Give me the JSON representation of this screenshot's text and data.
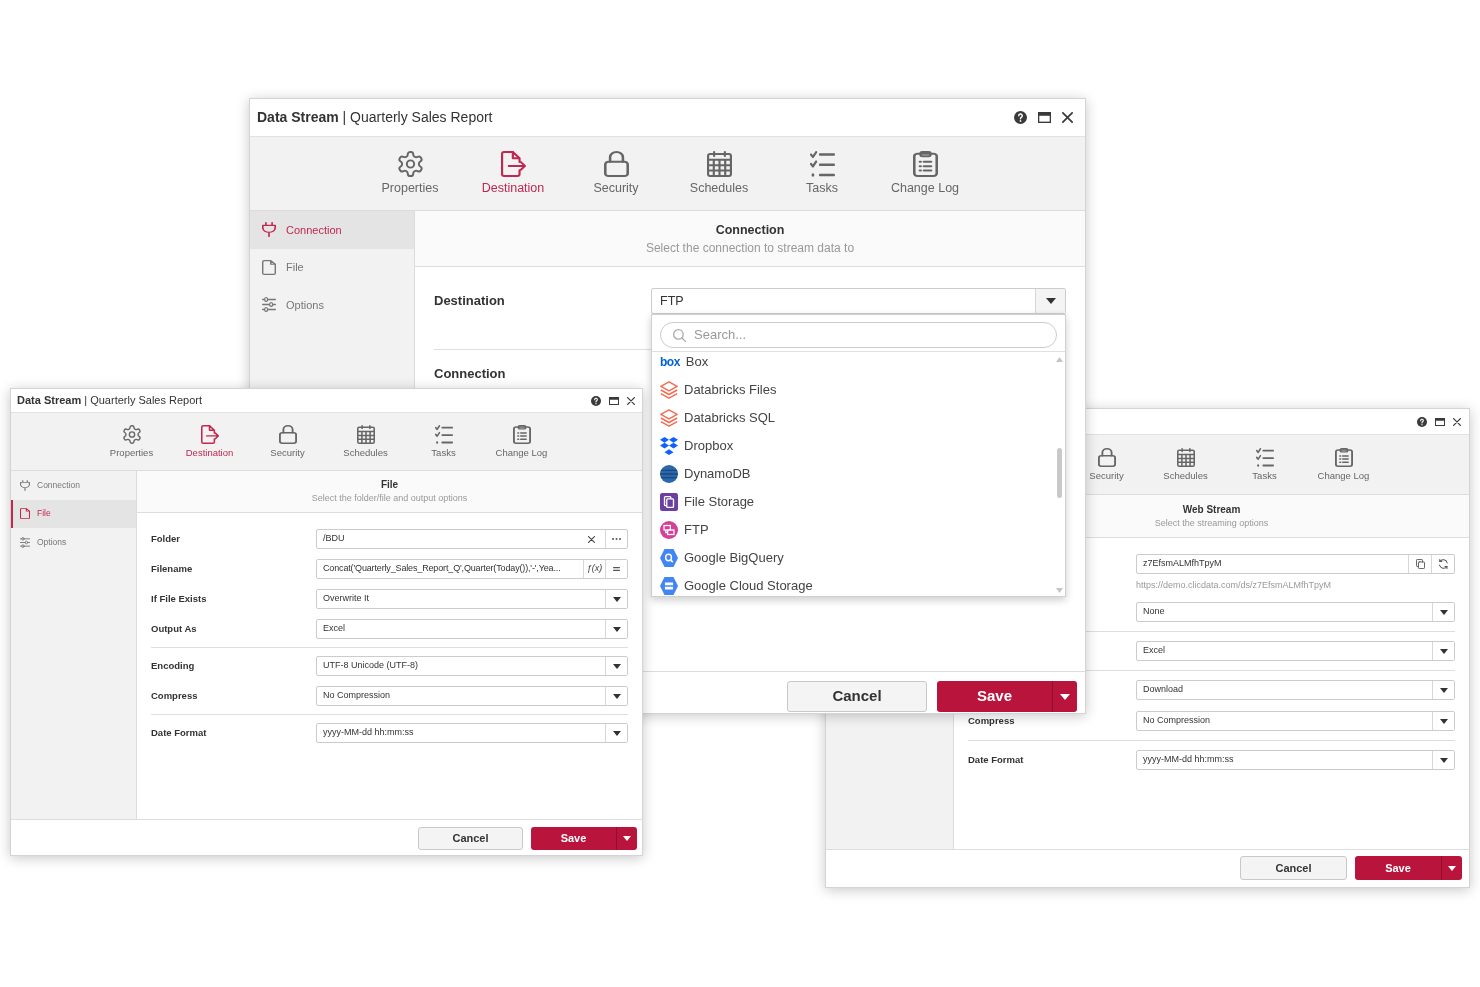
{
  "main_window": {
    "title": "**Data Stream** | Quarterly Sales Report",
    "tabs": [
      {
        "label": "Properties",
        "kind": "gear",
        "selected": false
      },
      {
        "label": "Destination",
        "kind": "export",
        "selected": true
      },
      {
        "label": "Security",
        "kind": "lock",
        "selected": false
      },
      {
        "label": "Schedules",
        "kind": "calendar",
        "selected": false
      },
      {
        "label": "Tasks",
        "kind": "checklist",
        "selected": false
      },
      {
        "label": "Change Log",
        "kind": "clipboard",
        "selected": false
      }
    ],
    "sidebar": [
      {
        "label": "Connection",
        "kind": "plug",
        "selected": true
      },
      {
        "label": "File",
        "kind": "file",
        "selected": false
      },
      {
        "label": "Options",
        "kind": "sliders",
        "selected": false
      }
    ],
    "section": {
      "title": "Connection",
      "subtitle": "Select the connection to stream data to"
    },
    "groups": [
      [
        {
          "label": "Destination",
          "kind": "select",
          "value": "FTP",
          "dropdown": {
            "placeholder": "Search...",
            "items": [
              {
                "label": "Box",
                "kind": "wordmark",
                "logo": "box"
              },
              {
                "label": "Databricks Files",
                "kind": "layers"
              },
              {
                "label": "Databricks SQL",
                "kind": "layers"
              },
              {
                "label": "Dropbox",
                "kind": "diamonds"
              },
              {
                "label": "DynamoDB",
                "kind": "cylinder"
              },
              {
                "label": "File Storage",
                "kind": "tile"
              },
              {
                "label": "FTP",
                "kind": "disc"
              },
              {
                "label": "Google BigQuery",
                "kind": "hex_search"
              },
              {
                "label": "Google Cloud Storage",
                "kind": "hex_bars"
              }
            ]
          }
        }
      ],
      [
        {
          "label": "Connection",
          "kind": "label"
        }
      ]
    ],
    "footer": {
      "cancel": "Cancel",
      "save": "Save"
    }
  },
  "front_window": {
    "title": "**Data Stream** | Quarterly Sales Report",
    "tabs": [
      {
        "label": "Properties",
        "kind": "gear",
        "selected": false
      },
      {
        "label": "Destination",
        "kind": "export",
        "selected": true
      },
      {
        "label": "Security",
        "kind": "lock",
        "selected": false
      },
      {
        "label": "Schedules",
        "kind": "calendar",
        "selected": false
      },
      {
        "label": "Tasks",
        "kind": "checklist",
        "selected": false
      },
      {
        "label": "Change Log",
        "kind": "clipboard",
        "selected": false
      }
    ],
    "sidebar": [
      {
        "label": "Connection",
        "kind": "plug",
        "selected": false
      },
      {
        "label": "File",
        "kind": "file",
        "selected": true
      },
      {
        "label": "Options",
        "kind": "sliders",
        "selected": false
      }
    ],
    "section": {
      "title": "File",
      "subtitle": "Select the folder/file and output options"
    },
    "groups": [
      [
        {
          "label": "Folder",
          "kind": "path",
          "value": "/BDU"
        },
        {
          "label": "Filename",
          "kind": "expression",
          "value": "Concat('Quarterly_Sales_Report_Q',Quarter(Today()),'-',Yea...",
          "function": "ƒ(x)"
        },
        {
          "label": "If File Exists",
          "kind": "select",
          "value": "Overwrite It"
        },
        {
          "label": "Output As",
          "kind": "select",
          "value": "Excel"
        }
      ],
      [
        {
          "label": "Encoding",
          "kind": "select",
          "value": "UTF-8 Unicode (UTF-8)"
        },
        {
          "label": "Compress",
          "kind": "select",
          "value": "No Compression"
        }
      ],
      [
        {
          "label": "Date Format",
          "kind": "select",
          "value": "yyyy-MM-dd hh:mm:ss"
        }
      ]
    ],
    "footer": {
      "cancel": "Cancel",
      "save": "Save"
    }
  },
  "back_window": {
    "tabs": [
      {
        "label": "Security",
        "kind": "lock",
        "selected": false
      },
      {
        "label": "Schedules",
        "kind": "calendar",
        "selected": false
      },
      {
        "label": "Tasks",
        "kind": "checklist",
        "selected": false
      },
      {
        "label": "Change Log",
        "kind": "clipboard",
        "selected": false
      }
    ],
    "section": {
      "title": "Web Stream",
      "subtitle": "Select the streaming options"
    },
    "groups": [
      [
        {
          "kind": "token",
          "value": "z7EfsmALMfhTpyM",
          "hint": "https://demo.clicdata.com/ds/z7EfsmALMfhTpyM"
        },
        {
          "kind": "select",
          "value": "None"
        }
      ],
      [
        {
          "kind": "select",
          "value": "Excel"
        }
      ],
      [
        {
          "kind": "select",
          "value": "Download"
        },
        {
          "label": "Compress",
          "kind": "select",
          "value": "No Compression"
        }
      ],
      [
        {
          "label": "Date Format",
          "kind": "select",
          "value": "yyyy-MM-dd hh:mm:ss"
        }
      ]
    ],
    "footer": {
      "cancel": "Cancel",
      "save": "Save"
    }
  }
}
